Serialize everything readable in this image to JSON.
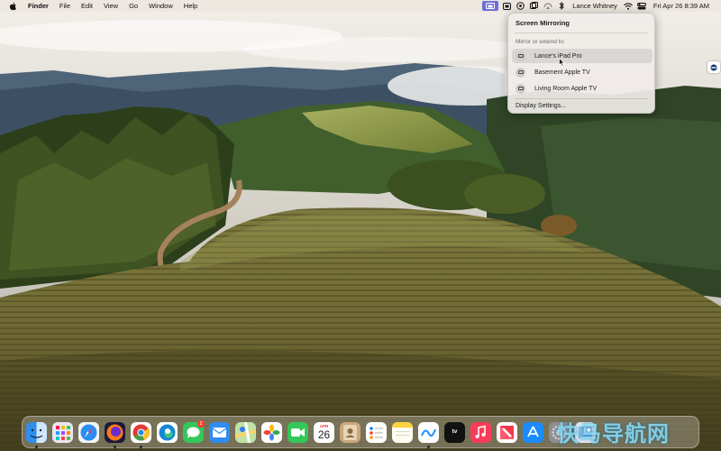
{
  "menubar": {
    "app_name": "Finder",
    "menus": [
      "File",
      "Edit",
      "View",
      "Go",
      "Window",
      "Help"
    ],
    "user_name": "Lance Whitney",
    "datetime": "Fri Apr 26  8:39 AM",
    "status_icons": [
      "screen-mirroring-icon",
      "keyboard-icon",
      "vpn-icon",
      "clipboard-icon",
      "airplay-icon",
      "bluetooth-icon",
      "wifi-icon",
      "control-center-icon"
    ]
  },
  "screen_mirroring": {
    "title": "Screen Mirroring",
    "section_label": "Mirror or extend to:",
    "devices": [
      {
        "name": "Lance's iPad Pro",
        "highlighted": true
      },
      {
        "name": "Basement Apple TV",
        "highlighted": false
      },
      {
        "name": "Living Room Apple TV",
        "highlighted": false
      }
    ],
    "settings_label": "Display Settings..."
  },
  "dock": {
    "calendar_month": "APR",
    "calendar_day": "26",
    "messages_badge": "2",
    "tv_label": "tv",
    "apps": [
      "Finder",
      "Launchpad",
      "Safari",
      "Firefox",
      "Chrome",
      "Edge",
      "Messages",
      "Mail",
      "Maps",
      "Photos",
      "FaceTime",
      "Calendar",
      "Contacts",
      "Reminders",
      "Notes",
      "Freeform",
      "TV",
      "Music",
      "News",
      "App Store",
      "System Settings",
      "Preview"
    ]
  },
  "watermark_text": "快马导航网",
  "colors": {
    "menubar_bg": "#ece6de",
    "highlight_accent": "#6a6fd8",
    "panel_bg": "#f0ece8"
  }
}
